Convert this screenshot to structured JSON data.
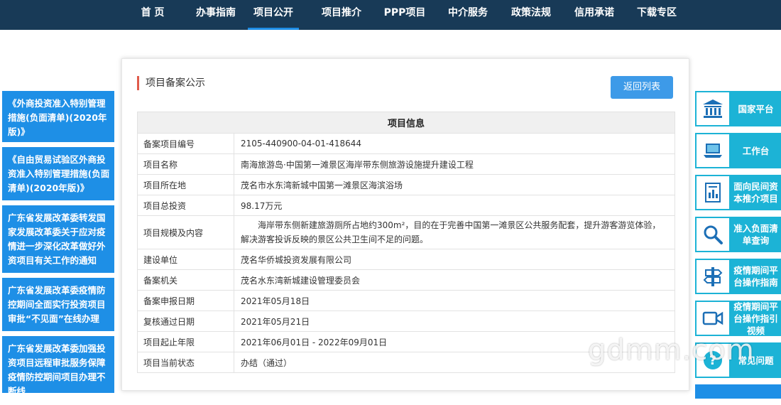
{
  "nav": {
    "items": [
      "首 页",
      "办事指南",
      "项目公开",
      "项目推介",
      "PPP项目",
      "中介服务",
      "政策法规",
      "信用承诺",
      "下载专区"
    ],
    "active_index": 2
  },
  "left_links": [
    "《外商投资准入特别管理措施(负面清单)(2020年版)》",
    "《自由贸易试验区外商投资准入特别管理措施(负面清单)(2020年版)》",
    "广东省发展改革委转发国家发展改革委关于应对疫情进一步深化改革做好外资项目有关工作的通知",
    "广东省发展改革委疫情防控期间全面实行投资项目审批“不见面”在线办理",
    "广东省发展改革委加强投资项目远程审批服务保障疫情防控期间项目办理不断线"
  ],
  "panel": {
    "title": "项目备案公示",
    "back_button": "返回列表",
    "table_header": "项目信息",
    "rows": [
      {
        "key": "备案项目编号",
        "value": "2105-440900-04-01-418644"
      },
      {
        "key": "项目名称",
        "value": "南海旅游岛·中国第一滩景区海岸带东侧旅游设施提升建设工程"
      },
      {
        "key": "项目所在地",
        "value": "茂名市水东湾新城中国第一滩景区海滨浴场"
      },
      {
        "key": "项目总投资",
        "value": "98.17万元"
      },
      {
        "key": "项目规模及内容",
        "value": "海岸带东侧新建旅游厕所占地约300m²，目的在于完善中国第一滩景区公共服务配套，提升游客游览体验，解决游客投诉反映的景区公共卫生间不足的问题。"
      },
      {
        "key": "建设单位",
        "value": "茂名华侨城投资发展有限公司"
      },
      {
        "key": "备案机关",
        "value": "茂名水东湾新城建设管理委员会"
      },
      {
        "key": "备案申报日期",
        "value": "2021年05月18日"
      },
      {
        "key": "复核通过日期",
        "value": "2021年05月21日"
      },
      {
        "key": "项目起止年限",
        "value": "2021年06月01日 - 2022年09月01日"
      },
      {
        "key": "项目当前状态",
        "value": "办结（通过）"
      }
    ]
  },
  "right_links": [
    {
      "label": "国家平台",
      "icon": "bank-icon"
    },
    {
      "label": "工作台",
      "icon": "laptop-icon"
    },
    {
      "label": "面向民间资本推介项目",
      "icon": "document-chart-icon"
    },
    {
      "label": "准入负面清单查询",
      "icon": "magnifier-icon"
    },
    {
      "label": "疫情期间平台操作指南",
      "icon": "signpost-icon"
    },
    {
      "label": "疫情期间平台操作指引视频",
      "icon": "video-camera-icon"
    },
    {
      "label": "常见问题",
      "icon": "question-icon"
    }
  ],
  "watermark": "gdmm.com"
}
